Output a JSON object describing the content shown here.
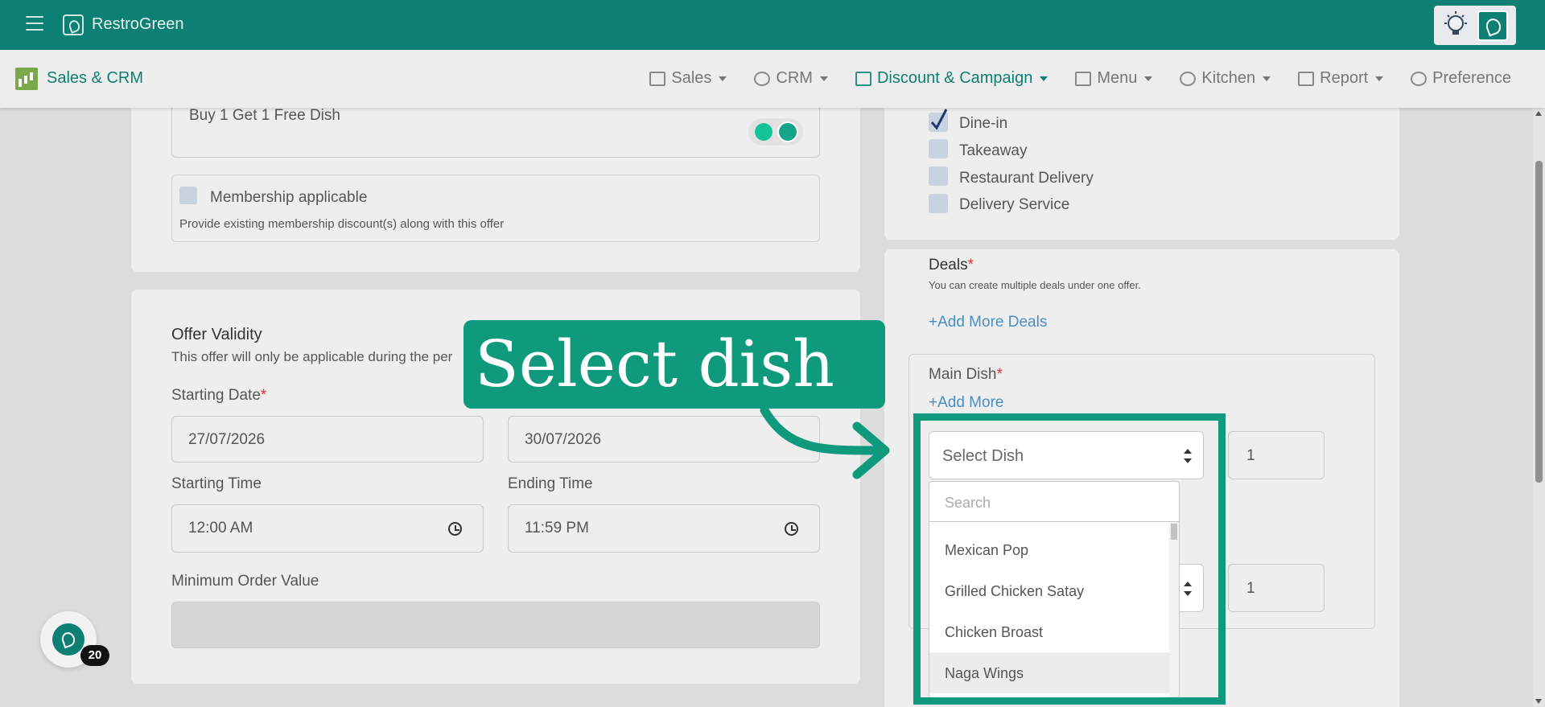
{
  "app": {
    "name": "RestroGreen"
  },
  "module": {
    "name": "Sales & CRM"
  },
  "nav": {
    "sales": "Sales",
    "crm": "CRM",
    "discount": "Discount & Campaign",
    "menu": "Menu",
    "kitchen": "Kitchen",
    "report": "Report",
    "preference": "Preference"
  },
  "offer": {
    "description_value": "Buy 1 Get 1 Free Dish",
    "membership_label": "Membership applicable",
    "membership_help": "Provide existing membership discount(s) along with this offer"
  },
  "validity": {
    "title": "Offer Validity",
    "subtitle": "This offer will only be applicable during the per",
    "start_date_label": "Starting Date",
    "start_date_value": "27/07/2026",
    "end_date_value": "30/07/2026",
    "start_time_label": "Starting Time",
    "start_time_value": "12:00 AM",
    "end_time_label": "Ending Time",
    "end_time_value": "11:59 PM",
    "min_order_label": "Minimum Order Value",
    "required_mark": "*"
  },
  "order_types": [
    "Dine-in",
    "Takeaway",
    "Restaurant Delivery",
    "Delivery Service"
  ],
  "deals": {
    "title": "Deals",
    "help": "You can create multiple deals under one offer.",
    "add_more_deals": "+Add More Deals",
    "main_dish_label": "Main Dish",
    "add_more": "+Add More",
    "select_placeholder": "Select Dish",
    "qty_1": "1",
    "qty_2": "1",
    "search_placeholder": "Search",
    "options": [
      "Mexican Pop",
      "Grilled Chicken Satay",
      "Chicken Broast",
      "Naga Wings"
    ]
  },
  "callout": {
    "text": "Select dish"
  },
  "fab": {
    "badge": "20"
  },
  "colors": {
    "brand": "#0d7f73",
    "highlight": "#0f9a7d",
    "link": "#4a8fc1"
  }
}
